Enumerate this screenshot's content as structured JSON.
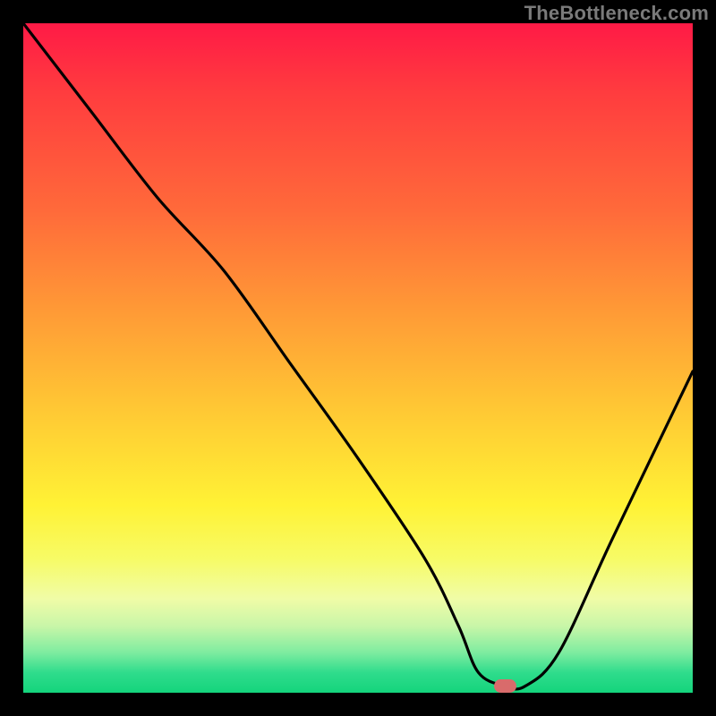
{
  "watermark": "TheBottleneck.com",
  "chart_data": {
    "type": "line",
    "title": "",
    "xlabel": "",
    "ylabel": "",
    "xlim": [
      0,
      100
    ],
    "ylim": [
      0,
      100
    ],
    "grid": false,
    "legend": false,
    "background_gradient": {
      "stops": [
        {
          "pos": 0,
          "color": "#ff1a46"
        },
        {
          "pos": 28,
          "color": "#ff6a3a"
        },
        {
          "pos": 58,
          "color": "#ffc934"
        },
        {
          "pos": 80,
          "color": "#f7fb66"
        },
        {
          "pos": 94,
          "color": "#7eeca0"
        },
        {
          "pos": 100,
          "color": "#14d47c"
        }
      ]
    },
    "series": [
      {
        "name": "bottleneck-curve",
        "color": "#000000",
        "x": [
          0,
          10,
          20,
          30,
          40,
          50,
          60,
          65,
          68,
          72,
          75,
          80,
          88,
          100
        ],
        "y": [
          100,
          87,
          74,
          63,
          49,
          35,
          20,
          10,
          3,
          1,
          1,
          6,
          23,
          48
        ]
      }
    ],
    "marker": {
      "name": "optimal-point",
      "x": 72,
      "y": 1,
      "color": "#d96b6b",
      "shape": "pill",
      "width_pct": 3.3,
      "height_pct": 2.0
    }
  }
}
